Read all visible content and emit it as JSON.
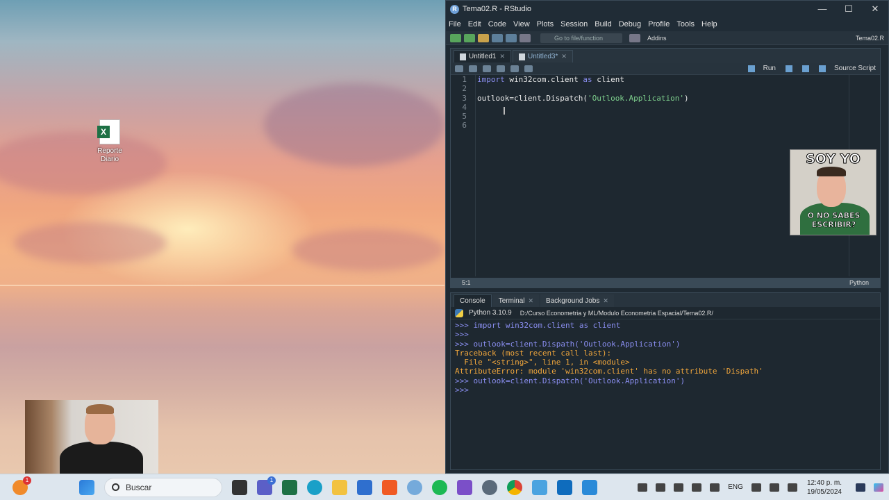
{
  "desktop": {
    "icon_label": "Reporte Diario"
  },
  "window": {
    "title": "Tema02.R - RStudio",
    "controls": [
      "—",
      "☐",
      "✕"
    ]
  },
  "menu": [
    "File",
    "Edit",
    "Code",
    "View",
    "Plots",
    "Session",
    "Build",
    "Debug",
    "Profile",
    "Tools",
    "Help"
  ],
  "toolbar": {
    "goto_placeholder": "Go to file/function",
    "addins": "Addins",
    "project": "Tema02.R"
  },
  "editor": {
    "tabs": [
      {
        "label": "Untitled1"
      },
      {
        "label": "Untitled3*"
      }
    ],
    "run_label": "Run",
    "source_label": "Source Script",
    "line_numbers": [
      "1",
      "2",
      "3",
      "4",
      "5",
      "6"
    ],
    "code": {
      "l1_kw1": "import",
      "l1_mid": " win32com.client ",
      "l1_kw2": "as",
      "l1_end": " client",
      "l3_pre": "outlook=client.Dispatch(",
      "l3_str": "'Outlook.Application'",
      "l3_post": ")"
    },
    "status_pos": "5:1",
    "status_lang": "Python"
  },
  "meme": {
    "top_text": "SOY YO",
    "bottom_text": "O NO SABES ESCRIBIR?"
  },
  "console": {
    "tabs": [
      "Console",
      "Terminal",
      "Background Jobs"
    ],
    "python_version": "Python 3.10.9",
    "path": "D:/Curso Econometria y ML/Modulo Econometria Espacial/Tema02.R/",
    "lines": [
      {
        "prompt": ">>>",
        "text": " import win32com.client as client"
      },
      {
        "prompt": ">>>",
        "text": ""
      },
      {
        "prompt": ">>>",
        "text": " outlook=client.Dispath('Outlook.Application')"
      }
    ],
    "errors": [
      "Traceback (most recent call last):",
      "  File \"<string>\", line 1, in <module>",
      "AttributeError: module 'win32com.client' has no attribute 'Dispath'"
    ],
    "last_line": {
      "prompt": ">>>",
      "text": " outlook=client.Dispatch('Outlook.Application')"
    },
    "final_prompt": ">>>"
  },
  "taskbar": {
    "search_placeholder": "Buscar",
    "lang": "ENG",
    "time": "12:40 p. m.",
    "date": "19/05/2024",
    "badge_left": "1",
    "badge_teams": "1"
  },
  "colors": {
    "accent": "#8a8ef0",
    "string": "#7ed08d",
    "error": "#f0a63c"
  }
}
